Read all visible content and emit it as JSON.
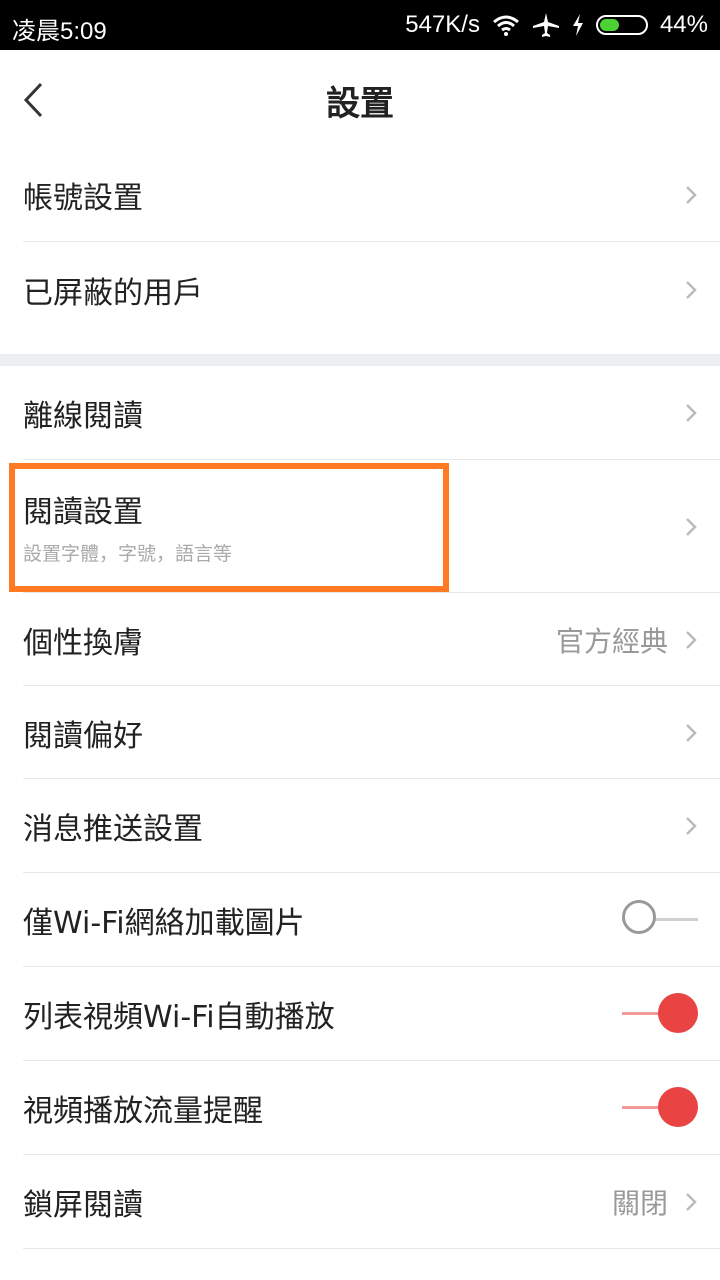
{
  "status_bar": {
    "time": "凌晨5:09",
    "speed": "547K/s",
    "battery": "44%",
    "battery_level": 0.44
  },
  "header": {
    "title": "設置"
  },
  "section1": {
    "items": [
      {
        "label": "帳號設置"
      },
      {
        "label": "已屏蔽的用戶"
      }
    ]
  },
  "section2": {
    "items": [
      {
        "label": "離線閱讀"
      },
      {
        "label": "閱讀設置",
        "sub": "設置字體，字號，語言等"
      },
      {
        "label": "個性換膚",
        "value": "官方經典"
      },
      {
        "label": "閱讀偏好"
      },
      {
        "label": "消息推送設置"
      },
      {
        "label": "僅Wi-Fi網絡加載圖片",
        "toggle": false
      },
      {
        "label": "列表視頻Wi-Fi自動播放",
        "toggle": true
      },
      {
        "label": "視頻播放流量提醒",
        "toggle": true
      },
      {
        "label": "鎖屏閱讀",
        "value": "關閉"
      }
    ]
  },
  "colors": {
    "accent_red": "#e94343",
    "highlight_orange": "#ff7a22"
  }
}
